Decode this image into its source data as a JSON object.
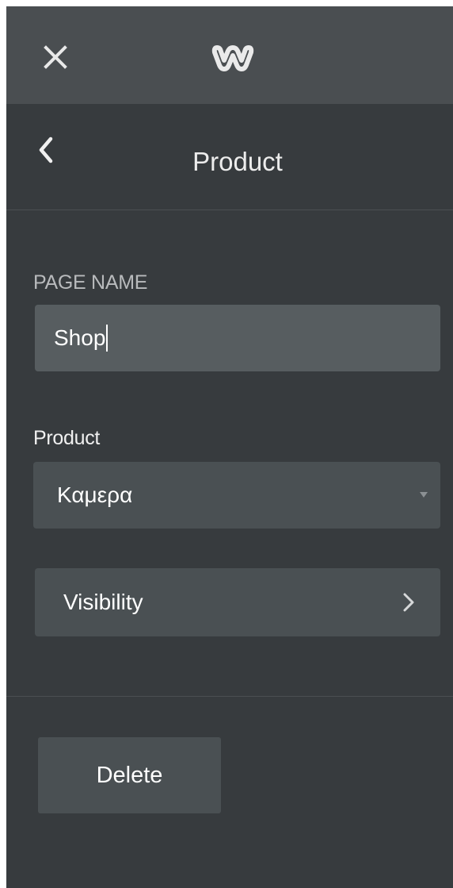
{
  "topbar": {
    "close_icon": "close-icon",
    "logo_icon": "weebly-logo-icon"
  },
  "header": {
    "back_icon": "chevron-left-icon",
    "title": "Product"
  },
  "page_name": {
    "label": "PAGE NAME",
    "value": "Shop"
  },
  "product": {
    "label": "Product",
    "selected": "Καμερα",
    "dropdown_icon": "caret-down-icon"
  },
  "visibility": {
    "label": "Visibility",
    "icon": "chevron-right-icon"
  },
  "actions": {
    "delete_label": "Delete"
  },
  "colors": {
    "panel_bg": "#373b3e",
    "topbar_bg": "#4a4e51",
    "input_bg": "#575d60",
    "control_bg": "#4a5053"
  }
}
